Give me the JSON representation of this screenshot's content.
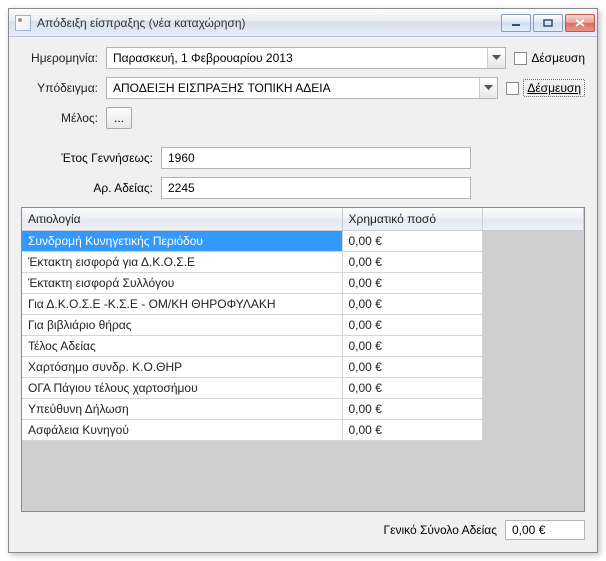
{
  "window": {
    "title": "Απόδειξη είσπραξης (νέα καταχώρηση)"
  },
  "form": {
    "date_label": "Ημερομηνία:",
    "date_value": "Παρασκευή,  1 Φεβρουαρίου 2013",
    "template_label": "Υπόδειγμα:",
    "template_value": "ΑΠΟΔΕΙΞΗ ΕΙΣΠΡΑΞΗΣ ΤΟΠΙΚΗ ΑΔΕΙΑ",
    "lock1_label": "Δέσμευση",
    "lock2_label": "Δέσμευση",
    "member_label": "Μέλος:",
    "member_button": "...",
    "birth_label": "Έτος Γεννήσεως:",
    "birth_value": "1960",
    "license_label": "Αρ. Αδείας:",
    "license_value": "2245"
  },
  "grid": {
    "col_reason": "Αιτιολογία",
    "col_amount": "Χρηματικό ποσό",
    "rows": [
      {
        "reason": "Συνδρομή Κυνηγετικής Περιόδου",
        "amount": "0,00 €"
      },
      {
        "reason": "Έκτακτη εισφορά για Δ.Κ.Ο.Σ.Ε",
        "amount": "0,00 €"
      },
      {
        "reason": "Έκτακτη εισφορά Συλλόγου",
        "amount": "0,00 €"
      },
      {
        "reason": "Για Δ.Κ.Ο.Σ.Ε -Κ.Σ.Ε - ΟΜ/ΚΗ ΘΗΡΟΦΥΛΑΚΗ",
        "amount": "0,00 €"
      },
      {
        "reason": "Για βιβλιάριο θήρας",
        "amount": "0,00 €"
      },
      {
        "reason": "Τέλος Αδείας",
        "amount": "0,00 €"
      },
      {
        "reason": "Χαρτόσημο συνδρ. Κ.Ο.ΘΗΡ",
        "amount": "0,00 €"
      },
      {
        "reason": "ΟΓΑ Πάγιου τέλους χαρτοσήμου",
        "amount": "0,00 €"
      },
      {
        "reason": "Υπεύθυνη Δήλωση",
        "amount": "0,00 €"
      },
      {
        "reason": "Ασφάλεια Κυνηγού",
        "amount": "0,00 €"
      }
    ]
  },
  "footer": {
    "total_label": "Γενικό Σύνολο Αδείας",
    "total_value": "0,00 €"
  }
}
